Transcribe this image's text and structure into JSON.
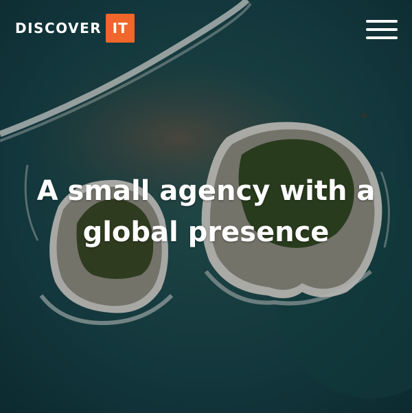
{
  "header": {
    "logo_text": "DISCOVER",
    "logo_badge": "IT",
    "menu_icon": "hamburger-menu-icon"
  },
  "hero": {
    "headline_line1": "A small agency with a",
    "headline_line2": "global presence",
    "background": "aerial-islands-ocean"
  },
  "colors": {
    "accent": "#f0662b",
    "ocean": "#0f3a3f",
    "text": "#ffffff"
  }
}
